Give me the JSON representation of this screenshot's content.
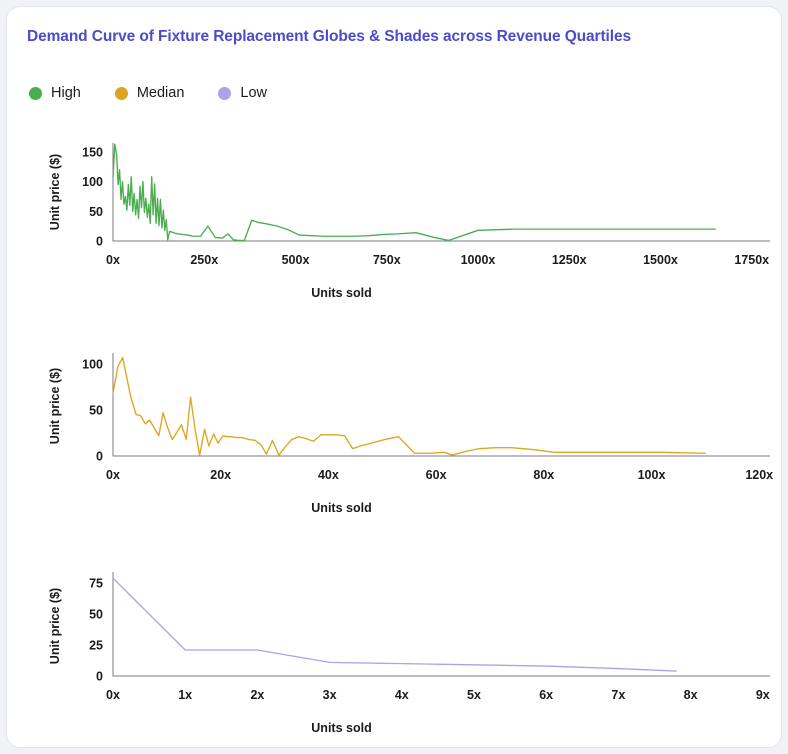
{
  "card": {
    "title": "Demand Curve of Fixture Replacement Globes & Shades across Revenue Quartiles",
    "title_color": "#4c4ccb",
    "background": "#ffffff"
  },
  "legend": {
    "position": "top-left",
    "items": [
      {
        "label": "High",
        "color": "#4aae4f",
        "marker": "circle-marker"
      },
      {
        "label": "Median",
        "color": "#dda520",
        "marker": "circle-marker"
      },
      {
        "label": "Low",
        "color": "#aba3ec",
        "marker": "circle-marker"
      }
    ]
  },
  "chart_data": [
    {
      "type": "line",
      "title": "Demand Curve of Fixture Replacement Globes & Shades across Revenue Quartiles",
      "panel": "High",
      "series_name": "High",
      "color": "#4aae4f",
      "xlabel": "Units sold",
      "ylabel": "Unit price ($)",
      "xlim": [
        0,
        1800
      ],
      "ylim": [
        0,
        165
      ],
      "xticks": [
        0,
        250,
        500,
        750,
        1000,
        1250,
        1500,
        1750
      ],
      "xticklabels": [
        "0x",
        "250x",
        "500x",
        "750x",
        "1000x",
        "1250x",
        "1500x",
        "1750x"
      ],
      "yticks": [
        0,
        50,
        100,
        150
      ],
      "yticklabels": [
        "0",
        "50",
        "100",
        "150"
      ],
      "grid": false,
      "x": [
        0,
        5,
        10,
        14,
        18,
        22,
        26,
        30,
        34,
        38,
        42,
        46,
        50,
        54,
        58,
        62,
        66,
        70,
        74,
        78,
        82,
        86,
        90,
        94,
        98,
        102,
        106,
        110,
        114,
        118,
        122,
        126,
        130,
        134,
        138,
        142,
        146,
        150,
        155,
        162,
        170,
        180,
        190,
        205,
        220,
        240,
        260,
        280,
        300,
        315,
        330,
        345,
        360,
        380,
        400,
        420,
        450,
        480,
        510,
        545,
        580,
        620,
        660,
        700,
        740,
        780,
        830,
        880,
        920,
        1000,
        1100,
        1250,
        1400,
        1550,
        1650
      ],
      "y": [
        108,
        163,
        145,
        95,
        120,
        70,
        100,
        62,
        75,
        52,
        95,
        60,
        108,
        50,
        80,
        44,
        70,
        38,
        92,
        56,
        100,
        48,
        72,
        40,
        62,
        30,
        108,
        44,
        96,
        30,
        72,
        26,
        70,
        22,
        52,
        18,
        36,
        2,
        16,
        15,
        13,
        12,
        11,
        10,
        8,
        8,
        25,
        6,
        5,
        12,
        2,
        1,
        1,
        35,
        31,
        29,
        25,
        19,
        10,
        9,
        8,
        8,
        8,
        9,
        11,
        12,
        14,
        6,
        1,
        18,
        20,
        20,
        20,
        20,
        20
      ]
    },
    {
      "type": "line",
      "panel": "Median",
      "series_name": "Median",
      "color": "#dda520",
      "xlabel": "Units sold",
      "ylabel": "Unit price ($)",
      "xlim": [
        0,
        122
      ],
      "ylim": [
        0,
        112
      ],
      "xticks": [
        0,
        20,
        40,
        60,
        80,
        100,
        120
      ],
      "xticklabels": [
        "0x",
        "20x",
        "40x",
        "60x",
        "80x",
        "100x",
        "120x"
      ],
      "yticks": [
        0,
        50,
        100
      ],
      "yticklabels": [
        "0",
        "50",
        "100"
      ],
      "grid": false,
      "x": [
        0,
        0.9,
        1.8,
        2.6,
        3.4,
        4.3,
        5.1,
        6.0,
        6.8,
        7.6,
        8.5,
        9.3,
        10.2,
        11.0,
        11.9,
        12.7,
        13.6,
        14.4,
        15.3,
        16.1,
        17.0,
        17.8,
        18.7,
        19.5,
        20.4,
        21.2,
        22.1,
        23.0,
        24.0,
        25.2,
        26.4,
        27.5,
        28.5,
        29.6,
        30.8,
        32.0,
        33.2,
        34.5,
        35.8,
        37.2,
        38.6,
        40.0,
        41.5,
        43.0,
        44.5,
        46.0,
        48.0,
        50.5,
        53.0,
        56.0,
        59.0,
        61.5,
        63.0,
        65.5,
        68.0,
        71.0,
        74.0,
        78.0,
        82.0,
        88.0,
        95.0,
        102.0,
        110.0
      ],
      "y": [
        68,
        97,
        107,
        84,
        62,
        45,
        44,
        35,
        39,
        31,
        22,
        47,
        30,
        18,
        26,
        34,
        18,
        64,
        27,
        1,
        29,
        11,
        24,
        14,
        22,
        21,
        21,
        20,
        20,
        18,
        17,
        12,
        2,
        17,
        1,
        10,
        18,
        21,
        19,
        16,
        23,
        23,
        23,
        22,
        8,
        11,
        14,
        18,
        21,
        3,
        3,
        4,
        1,
        5,
        8,
        9,
        9,
        7,
        4,
        4,
        4,
        4,
        3
      ]
    },
    {
      "type": "line",
      "panel": "Low",
      "series_name": "Low",
      "color": "#aba3ec",
      "xlabel": "Units sold",
      "ylabel": "Unit price ($)",
      "xlim": [
        0,
        9.1
      ],
      "ylim": [
        0,
        84
      ],
      "xticks": [
        0,
        1,
        2,
        3,
        4,
        5,
        6,
        7,
        8,
        9
      ],
      "xticklabels": [
        "0x",
        "1x",
        "2x",
        "3x",
        "4x",
        "5x",
        "6x",
        "7x",
        "8x",
        "9x"
      ],
      "yticks": [
        0,
        25,
        50,
        75
      ],
      "yticklabels": [
        "0",
        "25",
        "50",
        "75"
      ],
      "grid": false,
      "x": [
        0,
        1,
        2,
        3,
        4,
        5,
        6,
        7,
        7.8
      ],
      "y": [
        79,
        21,
        21,
        11,
        10,
        9,
        8,
        6,
        4
      ]
    }
  ]
}
